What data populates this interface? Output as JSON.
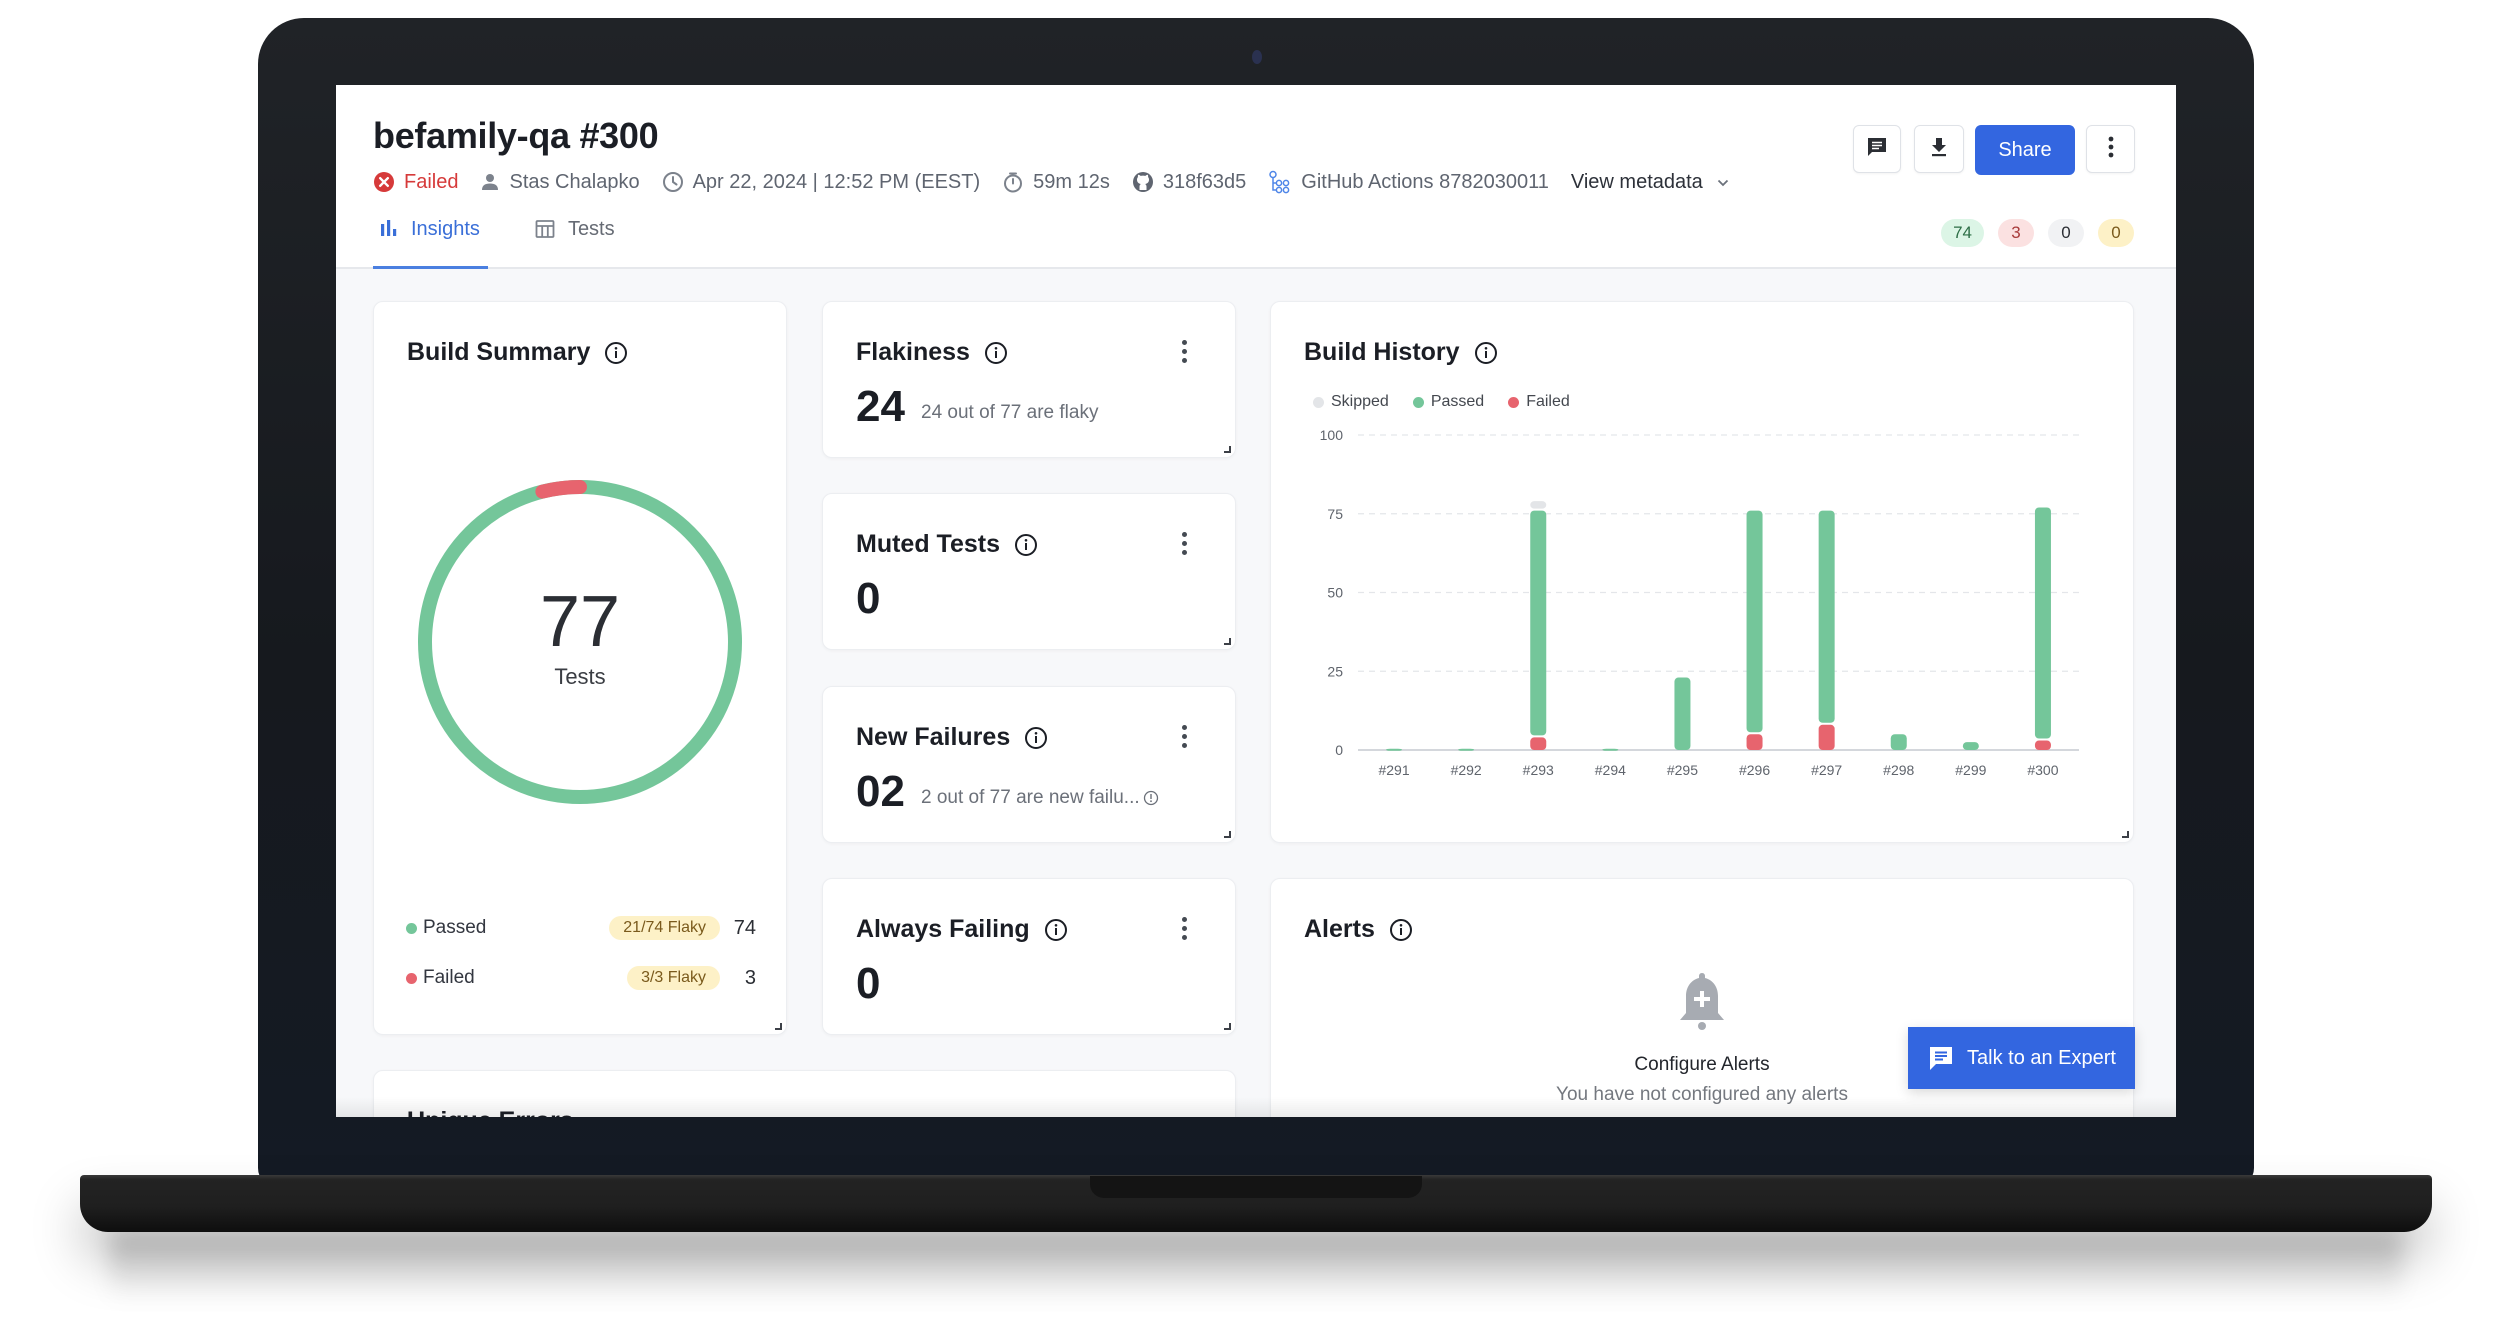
{
  "header": {
    "title": "befamily-qa #300",
    "status": "Failed",
    "author": "Stas Chalapko",
    "datetime": "Apr 22, 2024 | 12:52 PM (EEST)",
    "duration": "59m 12s",
    "commit": "318f63d5",
    "ci": "GitHub Actions 8782030011",
    "view_metadata": "View metadata",
    "share_label": "Share",
    "icons": {
      "status": "error-circle-icon",
      "author": "person-icon",
      "datetime": "clock-icon",
      "duration": "stopwatch-icon",
      "commit": "github-icon",
      "ci": "workflow-icon",
      "comment": "comment-icon",
      "download": "download-icon",
      "more": "more-vertical-icon"
    }
  },
  "tabs": [
    {
      "label": "Insights",
      "icon": "bar-chart-icon",
      "active": true
    },
    {
      "label": "Tests",
      "icon": "table-icon",
      "active": false
    }
  ],
  "status_badges": [
    {
      "value": "74",
      "kind": "passed",
      "bg": "#dcf5e6",
      "fg": "#2d6e46"
    },
    {
      "value": "3",
      "kind": "failed",
      "bg": "#fbe1e1",
      "fg": "#a83a3a"
    },
    {
      "value": "0",
      "kind": "skipped",
      "bg": "#f1f2f4",
      "fg": "#2b2e34"
    },
    {
      "value": "0",
      "kind": "flaky",
      "bg": "#fdf1c7",
      "fg": "#7a5a1c"
    }
  ],
  "colors": {
    "passed": "#74c69a",
    "failed": "#e7646e",
    "skipped": "#e3e5e8",
    "accent": "#3366e0"
  },
  "build_summary": {
    "title": "Build Summary",
    "total": "77",
    "total_label": "Tests",
    "passed_fraction": 0.961,
    "failed_fraction": 0.039,
    "rows": [
      {
        "label": "Passed",
        "flaky": "21/74 Flaky",
        "count": "74",
        "color": "#74c69a"
      },
      {
        "label": "Failed",
        "flaky": "3/3 Flaky",
        "count": "3",
        "color": "#e7646e"
      }
    ]
  },
  "flakiness": {
    "title": "Flakiness",
    "value": "24",
    "description": "24 out of 77 are flaky"
  },
  "muted_tests": {
    "title": "Muted Tests",
    "value": "0"
  },
  "new_failures": {
    "title": "New Failures",
    "value": "02",
    "description": "2 out of 77 are new failu..."
  },
  "always_failing": {
    "title": "Always Failing",
    "value": "0"
  },
  "bottom_card": {
    "title": "Unique Errors"
  },
  "alerts": {
    "title": "Alerts",
    "empty_title": "Configure Alerts",
    "empty_subtitle": "You have not configured any alerts",
    "icon": "bell-plus-icon"
  },
  "talk_to_expert": {
    "label": "Talk to an Expert",
    "icon": "chat-icon"
  },
  "chart_data": {
    "type": "bar",
    "stacked": true,
    "title": "Build History",
    "xlabel": "",
    "ylabel": "",
    "ylim": [
      0,
      100
    ],
    "yticks": [
      0,
      25,
      50,
      75,
      100
    ],
    "grid": true,
    "legend": "top-left",
    "categories": [
      "#291",
      "#292",
      "#293",
      "#294",
      "#295",
      "#296",
      "#297",
      "#298",
      "#299",
      "#300"
    ],
    "series": [
      {
        "name": "Failed",
        "color": "#e7646e",
        "values": [
          0,
          0,
          4,
          0,
          0,
          5,
          8,
          0,
          0,
          3
        ]
      },
      {
        "name": "Passed",
        "color": "#74c69a",
        "values": [
          0.4,
          0.4,
          72,
          0.4,
          23,
          71,
          68,
          5,
          2.5,
          74
        ]
      },
      {
        "name": "Skipped",
        "color": "#e3e5e8",
        "values": [
          0,
          0,
          3,
          0,
          0,
          0,
          0,
          0,
          0,
          0
        ]
      }
    ],
    "legend_order": [
      "Skipped",
      "Passed",
      "Failed"
    ]
  }
}
